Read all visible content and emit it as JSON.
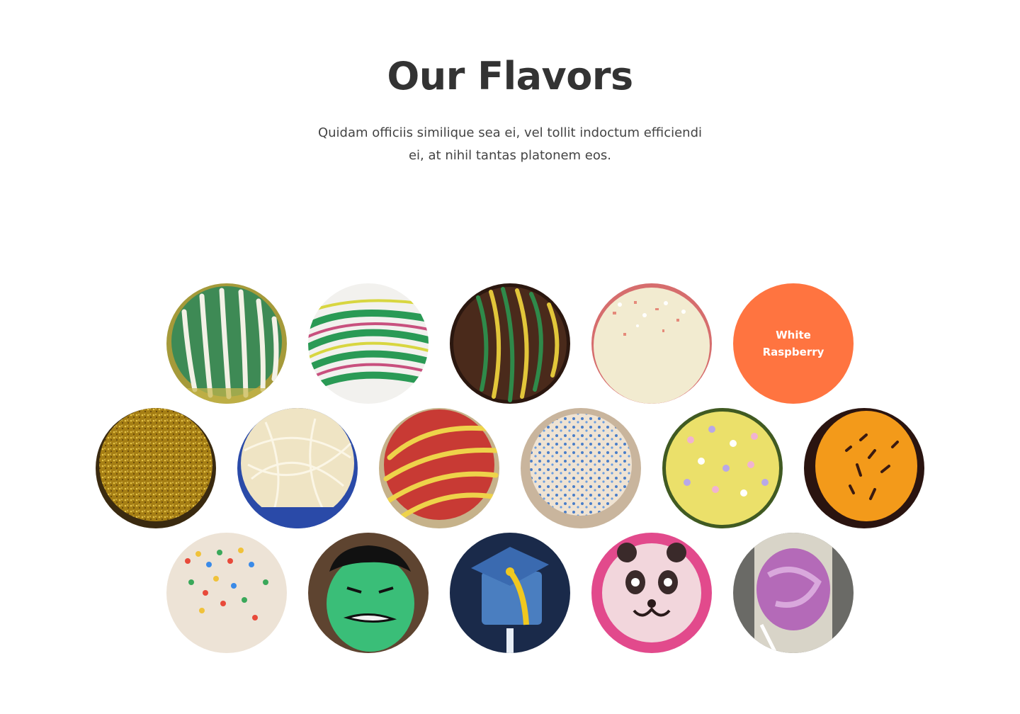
{
  "header": {
    "title": "Our Flavors",
    "subtitle": "Quidam officiis similique sea ei, vel tollit indoctum efficiendi ei, at nihil tantas platonem eos."
  },
  "flavors": {
    "highlight_color": "#ff7440",
    "hovered_label": "White Raspberry",
    "items": [
      {
        "row": 1,
        "icon": "green-white-striped-cake-ball"
      },
      {
        "row": 1,
        "icon": "green-yellow-pink-striped-cake-ball"
      },
      {
        "row": 1,
        "icon": "chocolate-green-yellow-striped-cake-ball"
      },
      {
        "row": 1,
        "icon": "white-sprinkled-cake-ball"
      },
      {
        "row": 1,
        "icon": "white-raspberry-cake-ball"
      },
      {
        "row": 2,
        "icon": "gold-glitter-cake-ball"
      },
      {
        "row": 2,
        "icon": "white-drizzle-cake-ball"
      },
      {
        "row": 2,
        "icon": "red-yellow-striped-cake-ball"
      },
      {
        "row": 2,
        "icon": "blue-sprinkle-cake-ball"
      },
      {
        "row": 2,
        "icon": "yellow-confetti-cake-ball"
      },
      {
        "row": 2,
        "icon": "orange-chocolate-sprinkle-cake-ball"
      },
      {
        "row": 3,
        "icon": "rainbow-sprinkle-cake-ball"
      },
      {
        "row": 3,
        "icon": "green-face-cake-pop"
      },
      {
        "row": 3,
        "icon": "graduation-cap-cake-pop"
      },
      {
        "row": 3,
        "icon": "panda-face-cake-pop"
      },
      {
        "row": 3,
        "icon": "pink-swirl-cake-pop"
      }
    ]
  }
}
